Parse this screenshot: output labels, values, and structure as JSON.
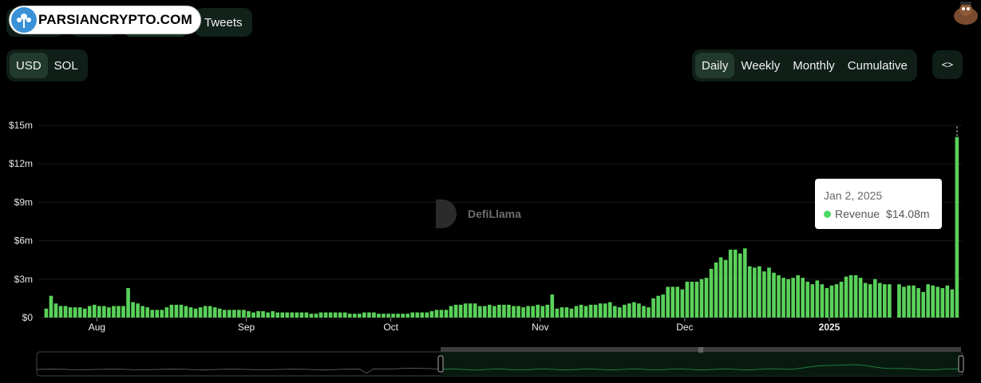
{
  "brand": {
    "watermark_logo": "PARSIANCRYPTO.COM",
    "chart_watermark": "DefiLlama"
  },
  "top_tabs": {
    "tweets": "Tweets"
  },
  "currency_toggle": {
    "options": [
      "USD",
      "SOL"
    ],
    "selected": "USD"
  },
  "period_toggle": {
    "options": [
      "Daily",
      "Weekly",
      "Monthly",
      "Cumulative"
    ],
    "selected": "Daily"
  },
  "embed_button": {
    "label": "<>"
  },
  "tooltip": {
    "date": "Jan 2, 2025",
    "series": "Revenue",
    "value": "$14.08m"
  },
  "colors": {
    "bar": "#5ad15a",
    "background": "#000000",
    "accent": "#4cd964"
  },
  "chart_data": {
    "type": "bar",
    "series": [
      {
        "name": "Revenue",
        "values": [
          0.7,
          1.7,
          1.1,
          0.9,
          0.9,
          0.8,
          0.8,
          0.8,
          0.7,
          0.9,
          1.0,
          0.9,
          0.9,
          0.8,
          0.9,
          0.9,
          0.9,
          2.3,
          1.2,
          1.1,
          0.9,
          0.8,
          0.6,
          0.6,
          0.6,
          0.8,
          1.0,
          1.0,
          1.0,
          0.9,
          0.8,
          0.7,
          0.8,
          0.9,
          0.9,
          0.8,
          0.7,
          0.6,
          0.6,
          0.6,
          0.6,
          0.6,
          0.5,
          0.4,
          0.5,
          0.5,
          0.4,
          0.5,
          0.4,
          0.4,
          0.4,
          0.4,
          0.4,
          0.4,
          0.4,
          0.3,
          0.3,
          0.4,
          0.4,
          0.4,
          0.4,
          0.4,
          0.4,
          0.3,
          0.3,
          0.3,
          0.4,
          0.4,
          0.4,
          0.3,
          0.3,
          0.3,
          0.3,
          0.3,
          0.3,
          0.3,
          0.4,
          0.4,
          0.4,
          0.4,
          0.5,
          0.6,
          0.6,
          0.6,
          0.9,
          1.0,
          1.0,
          1.1,
          1.1,
          1.1,
          0.9,
          0.9,
          1.0,
          0.9,
          1.0,
          1.0,
          1.0,
          0.9,
          0.9,
          0.8,
          0.9,
          0.9,
          1.0,
          0.9,
          1.0,
          1.8,
          0.7,
          0.8,
          0.8,
          0.7,
          0.9,
          1.0,
          0.9,
          1.0,
          1.0,
          1.1,
          1.1,
          1.2,
          0.9,
          0.8,
          1.0,
          1.1,
          1.2,
          1.1,
          0.9,
          0.8,
          1.5,
          1.7,
          1.8,
          2.4,
          2.4,
          2.4,
          2.2,
          2.8,
          2.8,
          2.8,
          3.0,
          3.1,
          3.8,
          4.3,
          4.7,
          4.5,
          5.3,
          5.3,
          5.0,
          5.4,
          4.0,
          3.9,
          4.0,
          3.6,
          3.9,
          3.5,
          3.3,
          3.1,
          3.0,
          3.1,
          3.3,
          3.1,
          2.8,
          2.6,
          2.9,
          2.6,
          2.3,
          2.5,
          2.6,
          2.8,
          3.2,
          3.3,
          3.3,
          3.1,
          2.7,
          2.6,
          3.0,
          2.7,
          2.6,
          2.6,
          null,
          2.6,
          2.4,
          2.5,
          2.5,
          2.3,
          2.0,
          2.6,
          2.5,
          2.4,
          2.3,
          2.5,
          2.2,
          14.08
        ]
      }
    ],
    "x_tick_labels": [
      "Aug",
      "Sep",
      "Oct",
      "Nov",
      "Dec",
      "2025"
    ],
    "y_tick_labels": [
      "$0",
      "$3m",
      "$6m",
      "$9m",
      "$12m",
      "$15m"
    ],
    "ylim": [
      0,
      15
    ],
    "grid": true,
    "legend": "none"
  }
}
